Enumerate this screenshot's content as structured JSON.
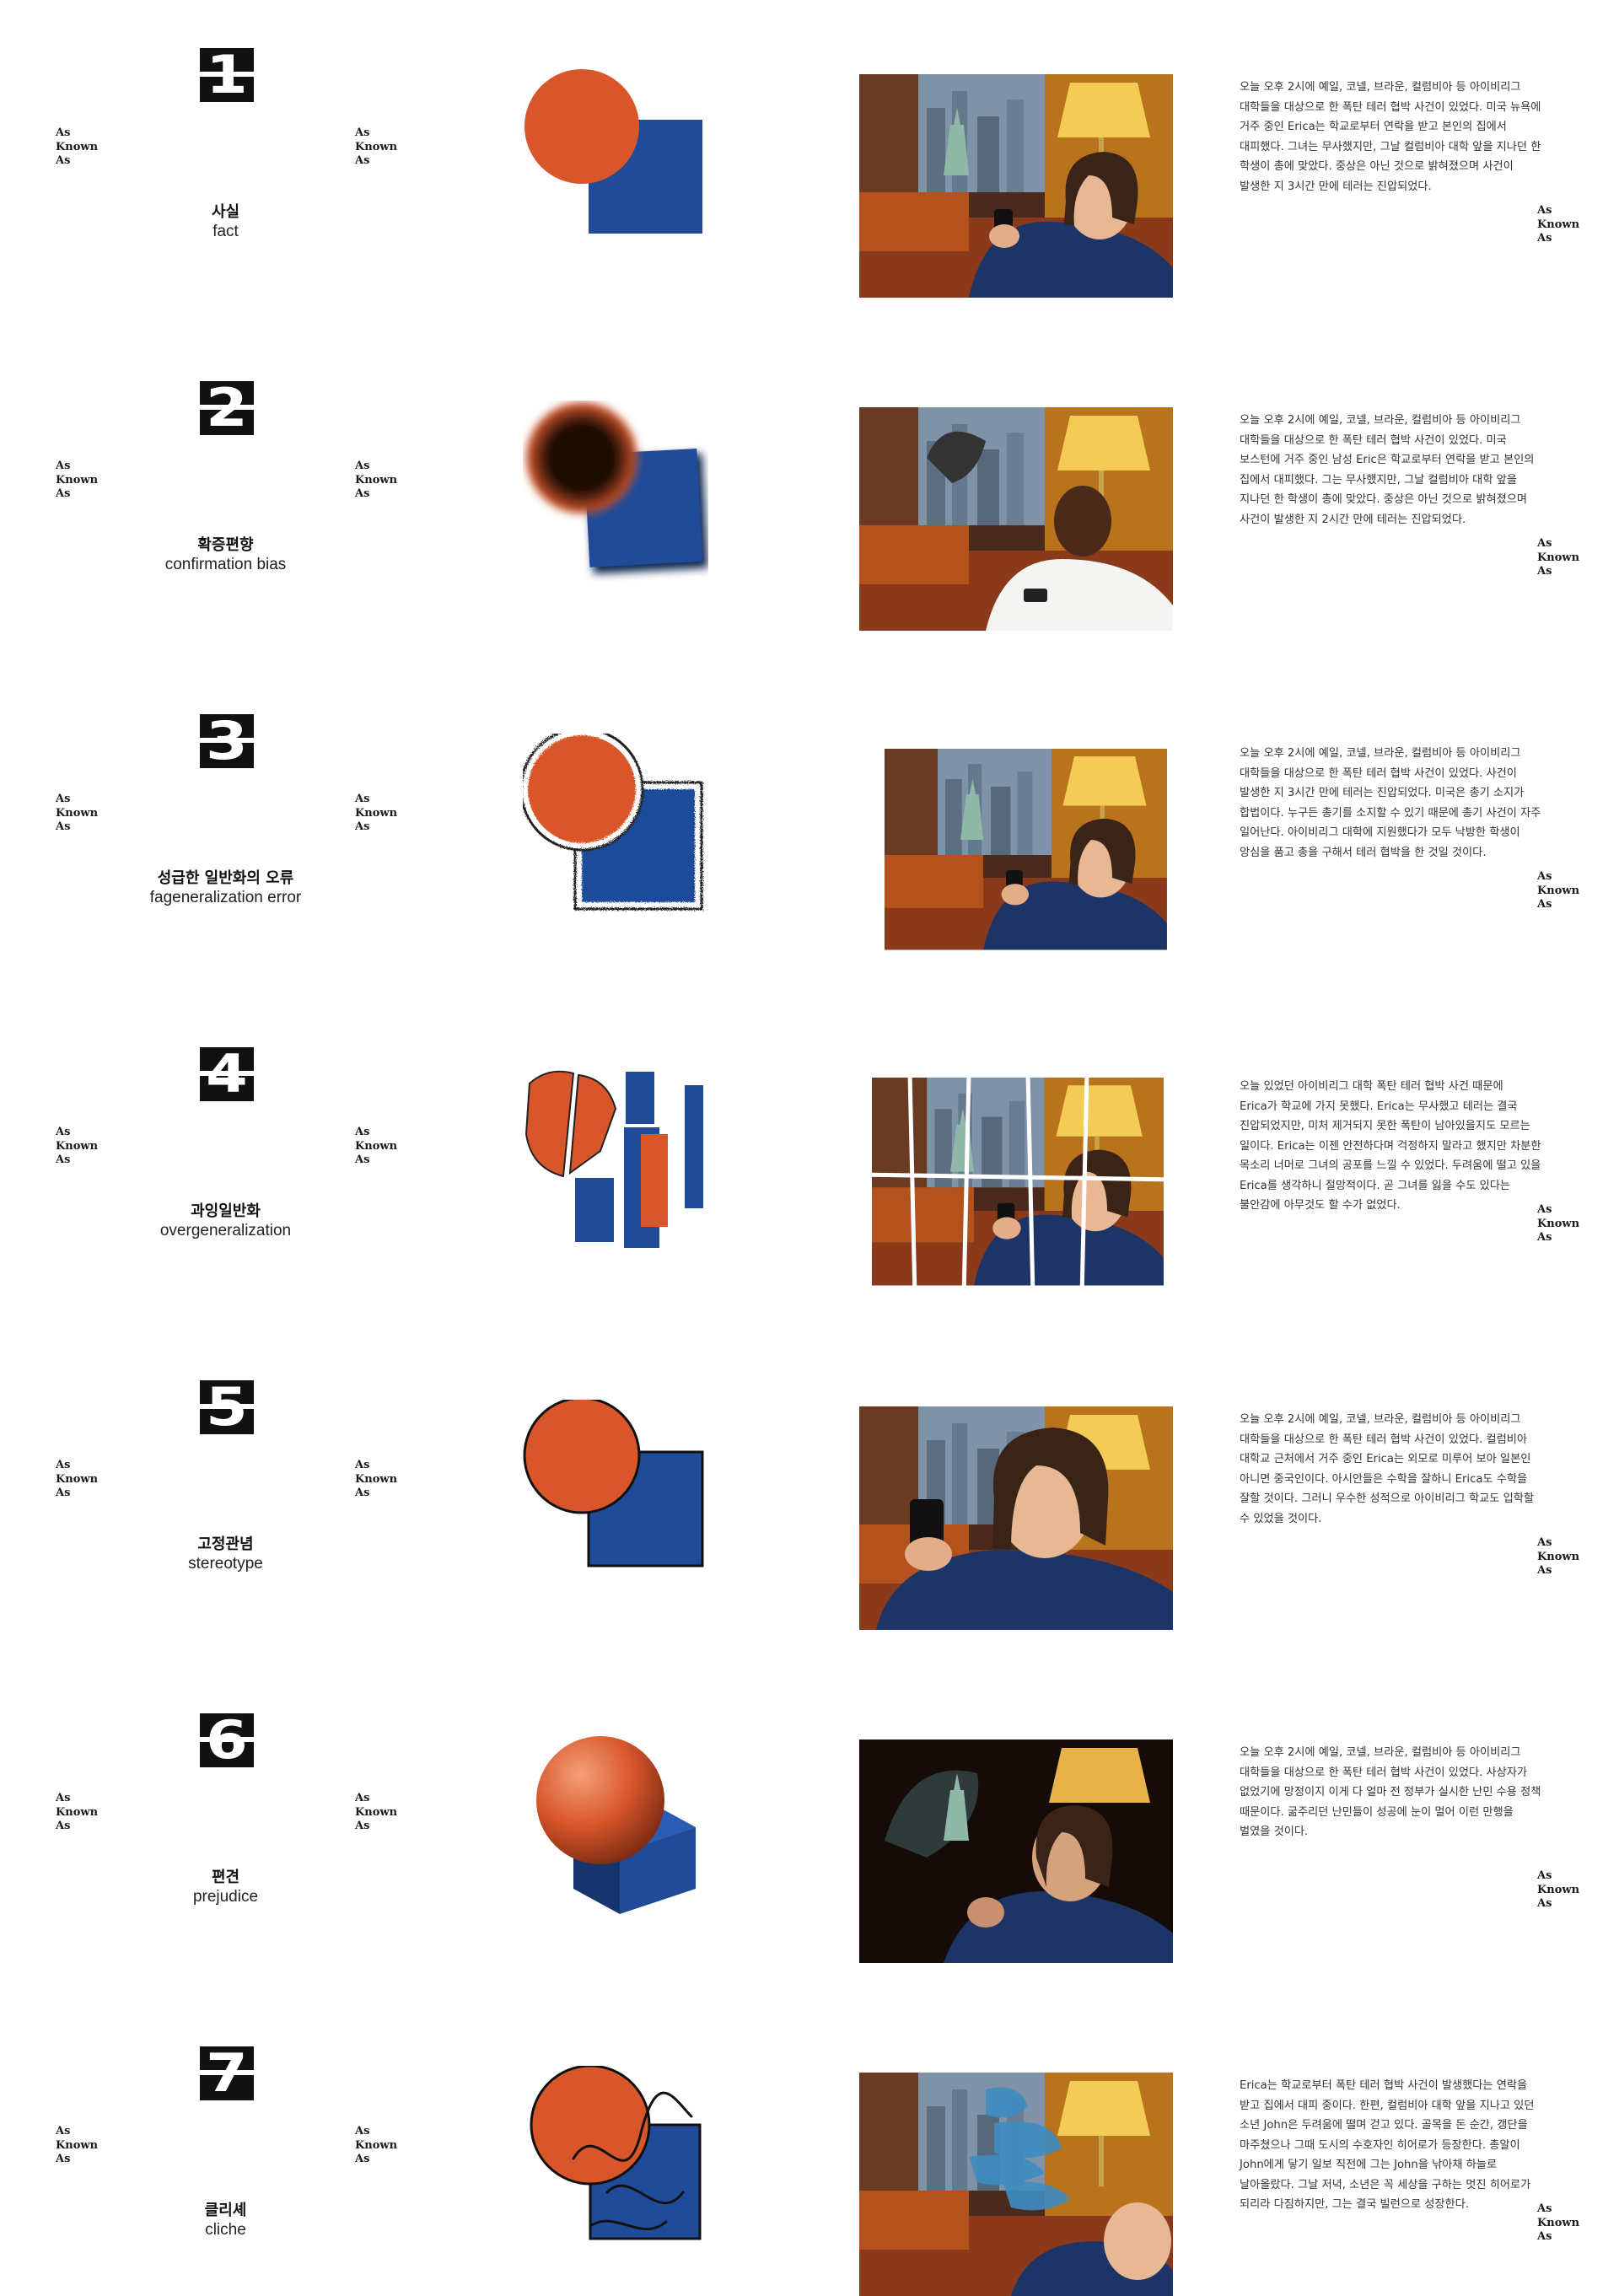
{
  "brand_mark": "As\nKnown\nAs",
  "colors": {
    "orange": "#d9562a",
    "blue": "#1f4b99",
    "ink": "#111111"
  },
  "cards": [
    {
      "number": "1",
      "title_ko": "사실",
      "title_en": "fact",
      "shape_style": "flat",
      "photo_subject": "woman-phone-sofa",
      "caption": "오늘 오후 2시에 예일, 코넬, 브라운, 컬럼비아 등 아이비리그 대학들을 대상으로 한 폭탄 테러 협박 사건이 있었다. 미국 뉴욕에 거주 중인 Erica는 학교로부터 연락을 받고 본인의 집에서 대피했다. 그녀는 무사했지만, 그날 컬럼비아 대학 앞을 지나던 한 학생이 총에 맞았다. 중상은 아닌 것으로 밝혀졌으며 사건이 발생한 지 3시간 만에 테러는 진압되었다."
    },
    {
      "number": "2",
      "title_ko": "확증편향",
      "title_en": "confirmation bias",
      "shape_style": "blurred-dark",
      "photo_subject": "man-phone-sofa",
      "caption": "오늘 오후 2시에 예일, 코넬, 브라운, 컬럼비아 등 아이비리그 대학들을 대상으로 한 폭탄 테러 협박 사건이 있었다. 미국 보스턴에 거주 중인 남성 Eric은 학교로부터 연락을 받고 본인의 집에서 대피했다. 그는 무사했지만, 그날 컬럼비아 대학 앞을 지나던 한 학생이 총에 맞았다. 중상은 아닌 것으로 밝혀졌으며 사건이 발생한 지 2시간 만에 테러는 진압되었다."
    },
    {
      "number": "3",
      "title_ko": "성급한 일반화의 오류",
      "title_en": "fageneralization error",
      "shape_style": "crayon",
      "photo_subject": "drawn-woman-phone",
      "caption": "오늘 오후 2시에 예일, 코넬, 브라운, 컬럼비아 등 아이비리그 대학들을 대상으로 한 폭탄 테러 협박 사건이 있었다. 사건이 발생한 지 3시간 만에 테러는 진압되었다. 미국은 총기 소지가 합법이다. 누구든 총기를 소지할 수 있기 때문에 총기 사건이 자주 일어난다. 아이비리그 대학에 지원했다가 모두 낙방한 학생이 앙심을 품고 총을 구해서 테러 협박을 한 것일 것이다."
    },
    {
      "number": "4",
      "title_ko": "과잉일반화",
      "title_en": "overgeneralization",
      "shape_style": "torn",
      "photo_subject": "torn-collage",
      "caption": "오늘 있었던 아이비리그 대학 폭탄 테러 협박 사건 때문에 Erica가 학교에 가지 못했다. Erica는 무사했고 테러는 결국 진압되었지만, 미처 제거되지 못한 폭탄이 남아있을지도 모르는 일이다. Erica는 이젠 안전하다며 걱정하지 말라고 했지만 차분한 목소리 너머로 그녀의 공포를 느낄 수 있었다. 두려움에 떨고 있을 Erica를 생각하니 절망적이다. 곧 그녀를 잃을 수도 있다는 불안감에 아무것도 할 수가 없었다."
    },
    {
      "number": "5",
      "title_ko": "고정관념",
      "title_en": "stereotype",
      "shape_style": "outlined",
      "photo_subject": "woman-closeup",
      "caption": "오늘 오후 2시에 예일, 코넬, 브라운, 컬럼비아 등 아이비리그 대학들을 대상으로 한 폭탄 테러 협박 사건이 있었다. 컬럼비아 대학교 근처에서 거주 중인 Erica는 외모로 미루어 보아 일본인 아니면 중국인이다. 아시안들은 수학을 잘하니 Erica도 수학을 잘할 것이다. 그러니 우수한 성적으로 아이비리그 학교도 입학할 수 있었을 것이다."
    },
    {
      "number": "6",
      "title_ko": "편견",
      "title_en": "prejudice",
      "shape_style": "3d",
      "photo_subject": "woman-painted-face",
      "caption": "오늘 오후 2시에 예일, 코넬, 브라운, 컬럼비아 등 아이비리그 대학들을 대상으로 한 폭탄 테러 협박 사건이 있었다. 사상자가 없었기에 망정이지 이게 다 얼마 전 정부가 실시한 난민 수용 정책 때문이다. 굶주리던 난민들이 성공에 눈이 멀어 이런 만행을 벌였을 것이다."
    },
    {
      "number": "7",
      "title_ko": "클리셰",
      "title_en": "cliche",
      "shape_style": "scribble",
      "photo_subject": "hero-splash",
      "caption": "Erica는 학교로부터 폭탄 테러 협박 사건이 발생했다는 연락을 받고 집에서 대피 중이다. 한편, 컬럼비아 대학 앞을 지나고 있던 소년 John은 두려움에 떨며 걷고 있다. 골목을 돈 순간, 갱단을 마주쳤으나 그때 도시의 수호자인 히어로가 등장한다. 총알이 John에게 닿기 일보 직전에 그는 John을 낚아채 하늘로 날아올랐다. 그날 저녁, 소년은 꼭 세상을 구하는 멋진 히어로가 되리라 다짐하지만, 그는 결국 빌런으로 성장한다."
    }
  ]
}
